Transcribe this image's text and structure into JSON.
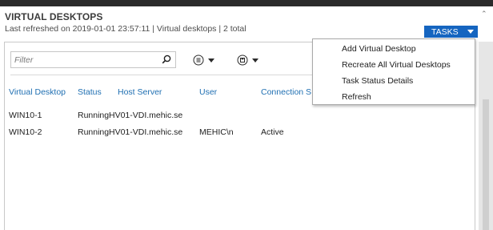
{
  "header": {
    "title": "VIRTUAL DESKTOPS",
    "subtitle": "Last refreshed on 2019-01-01 23:57:11 | Virtual desktops  | 2 total",
    "tasks_label": "TASKS"
  },
  "filter": {
    "placeholder": "Filter"
  },
  "table": {
    "columns": [
      "Virtual Desktop",
      "Status",
      "Host Server",
      "User",
      "Connection S"
    ],
    "rows": [
      [
        "WIN10-1",
        "Running",
        "HV01-VDI.mehic.se",
        "",
        ""
      ],
      [
        "WIN10-2",
        "Running",
        "HV01-VDI.mehic.se",
        "MEHIC\\n",
        "Active"
      ]
    ]
  },
  "tasks_menu": {
    "items": [
      "Add Virtual Desktop",
      "Recreate All Virtual Desktops",
      "Task Status Details",
      "Refresh"
    ]
  },
  "icons": {
    "search": "search-icon",
    "list": "list-options-icon",
    "save": "save-icon",
    "scroll_up": "chevron-up-icon"
  },
  "colors": {
    "accent": "#1565c0",
    "header_text": "#1f6fb2"
  }
}
